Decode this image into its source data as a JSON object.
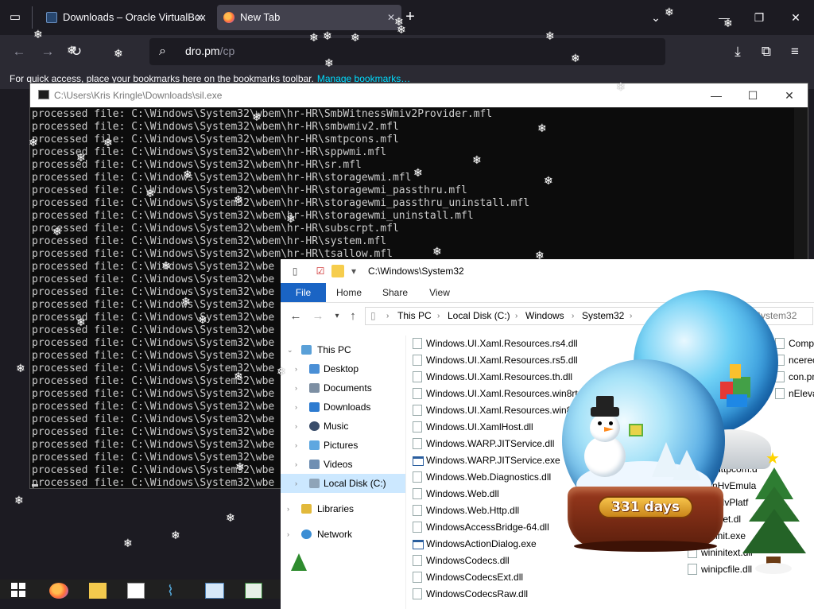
{
  "browser": {
    "tabs": [
      {
        "label": "Downloads – Oracle VirtualBox",
        "close": "✕"
      },
      {
        "label": "New Tab",
        "close": "✕"
      }
    ],
    "new_tab": "+",
    "tabs_list_icon": "tab-list-icon",
    "url": {
      "host": "dro.pm",
      "path": "/cp"
    },
    "bookmarks_bar": {
      "text": "For quick access, place your bookmarks here on the bookmarks toolbar.",
      "link": "Manage bookmarks…"
    }
  },
  "console": {
    "title": "C:\\Users\\Kris Kringle\\Downloads\\sil.exe",
    "lines": [
      "processed file: C:\\Windows\\System32\\wbem\\hr-HR\\SmbWitnessWmiv2Provider.mfl",
      "processed file: C:\\Windows\\System32\\wbem\\hr-HR\\smbwmiv2.mfl",
      "processed file: C:\\Windows\\System32\\wbem\\hr-HR\\smtpcons.mfl",
      "processed file: C:\\Windows\\System32\\wbem\\hr-HR\\sppwmi.mfl",
      "processed file: C:\\Windows\\System32\\wbem\\hr-HR\\sr.mfl",
      "processed file: C:\\Windows\\System32\\wbem\\hr-HR\\storagewmi.mfl",
      "processed file: C:\\Windows\\System32\\wbem\\hr-HR\\storagewmi_passthru.mfl",
      "processed file: C:\\Windows\\System32\\wbem\\hr-HR\\storagewmi_passthru_uninstall.mfl",
      "processed file: C:\\Windows\\System32\\wbem\\hr-HR\\storagewmi_uninstall.mfl",
      "processed file: C:\\Windows\\System32\\wbem\\hr-HR\\subscrpt.mfl",
      "processed file: C:\\Windows\\System32\\wbem\\hr-HR\\system.mfl",
      "processed file: C:\\Windows\\System32\\wbem\\hr-HR\\tsallow.mfl",
      "processed file: C:\\Windows\\System32\\wbe",
      "processed file: C:\\Windows\\System32\\wbe",
      "processed file: C:\\Windows\\System32\\wbe",
      "processed file: C:\\Windows\\System32\\wbe",
      "processed file: C:\\Windows\\System32\\wbe",
      "processed file: C:\\Windows\\System32\\wbe",
      "processed file: C:\\Windows\\System32\\wbe",
      "processed file: C:\\Windows\\System32\\wbe",
      "processed file: C:\\Windows\\System32\\wbe",
      "processed file: C:\\Windows\\System32\\wbe",
      "processed file: C:\\Windows\\System32\\wbe",
      "processed file: C:\\Windows\\System32\\wbe",
      "processed file: C:\\Windows\\System32\\wbe",
      "processed file: C:\\Windows\\System32\\wbe",
      "processed file: C:\\Windows\\System32\\wbe",
      "processed file: C:\\Windows\\System32\\wbe",
      "processed file: C:\\Windows\\System32\\wbe",
      "processed file: C:\\Windows\\System32\\wbe"
    ]
  },
  "explorer": {
    "title": "C:\\Windows\\System32",
    "ribbon_tabs": [
      "File",
      "Home",
      "Share",
      "View"
    ],
    "breadcrumb": [
      "This PC",
      "Local Disk (C:)",
      "Windows",
      "System32"
    ],
    "search_fragment": "h System32",
    "nav": [
      {
        "label": "This PC",
        "expanded": true
      },
      {
        "label": "Desktop"
      },
      {
        "label": "Documents"
      },
      {
        "label": "Downloads"
      },
      {
        "label": "Music"
      },
      {
        "label": "Pictures"
      },
      {
        "label": "Videos"
      },
      {
        "label": "Local Disk (C:)",
        "selected": true
      },
      {
        "label": "Libraries"
      },
      {
        "label": "Network"
      }
    ],
    "files_col1": [
      {
        "name": "Windows.UI.Xaml.Resources.rs4.dll",
        "type": "dll"
      },
      {
        "name": "Windows.UI.Xaml.Resources.rs5.dll",
        "type": "dll"
      },
      {
        "name": "Windows.UI.Xaml.Resources.th.dll",
        "type": "dll"
      },
      {
        "name": "Windows.UI.Xaml.Resources.win8rtm",
        "type": "dll"
      },
      {
        "name": "Windows.UI.Xaml.Resources.win81",
        "type": "dll"
      },
      {
        "name": "Windows.UI.XamlHost.dll",
        "type": "dll"
      },
      {
        "name": "Windows.WARP.JITService.dll",
        "type": "dll"
      },
      {
        "name": "Windows.WARP.JITService.exe",
        "type": "exe"
      },
      {
        "name": "Windows.Web.Diagnostics.dll",
        "type": "dll"
      },
      {
        "name": "Windows.Web.dll",
        "type": "dll"
      },
      {
        "name": "Windows.Web.Http.dll",
        "type": "dll"
      },
      {
        "name": "WindowsAccessBridge-64.dll",
        "type": "dll"
      },
      {
        "name": "WindowsActionDialog.exe",
        "type": "exe"
      },
      {
        "name": "WindowsCodecs.dll",
        "type": "dll"
      },
      {
        "name": "WindowsCodecsExt.dll",
        "type": "dll"
      },
      {
        "name": "WindowsCodecsRaw.dll",
        "type": "dll"
      }
    ],
    "files_col2": [
      {
        "name": "Compo",
        "type": "dll"
      },
      {
        "name": "ncerec",
        "type": "dll"
      },
      {
        "name": "con.png",
        "type": "dll"
      },
      {
        "name": "nElevated",
        "type": "dll"
      },
      {
        "name": "winhttpcom.d",
        "type": "dll"
      },
      {
        "name": "WinHvEmula",
        "type": "dll"
      },
      {
        "name": "WinHvPlatf",
        "type": "dll"
      },
      {
        "name": "wininet.dl",
        "type": "dll"
      },
      {
        "name": "wininit.exe",
        "type": "exe"
      },
      {
        "name": "wininitext.dll",
        "type": "dll"
      },
      {
        "name": "winipcfile.dll",
        "type": "dll"
      }
    ]
  },
  "decoration": {
    "countdown_label": "331 days"
  }
}
